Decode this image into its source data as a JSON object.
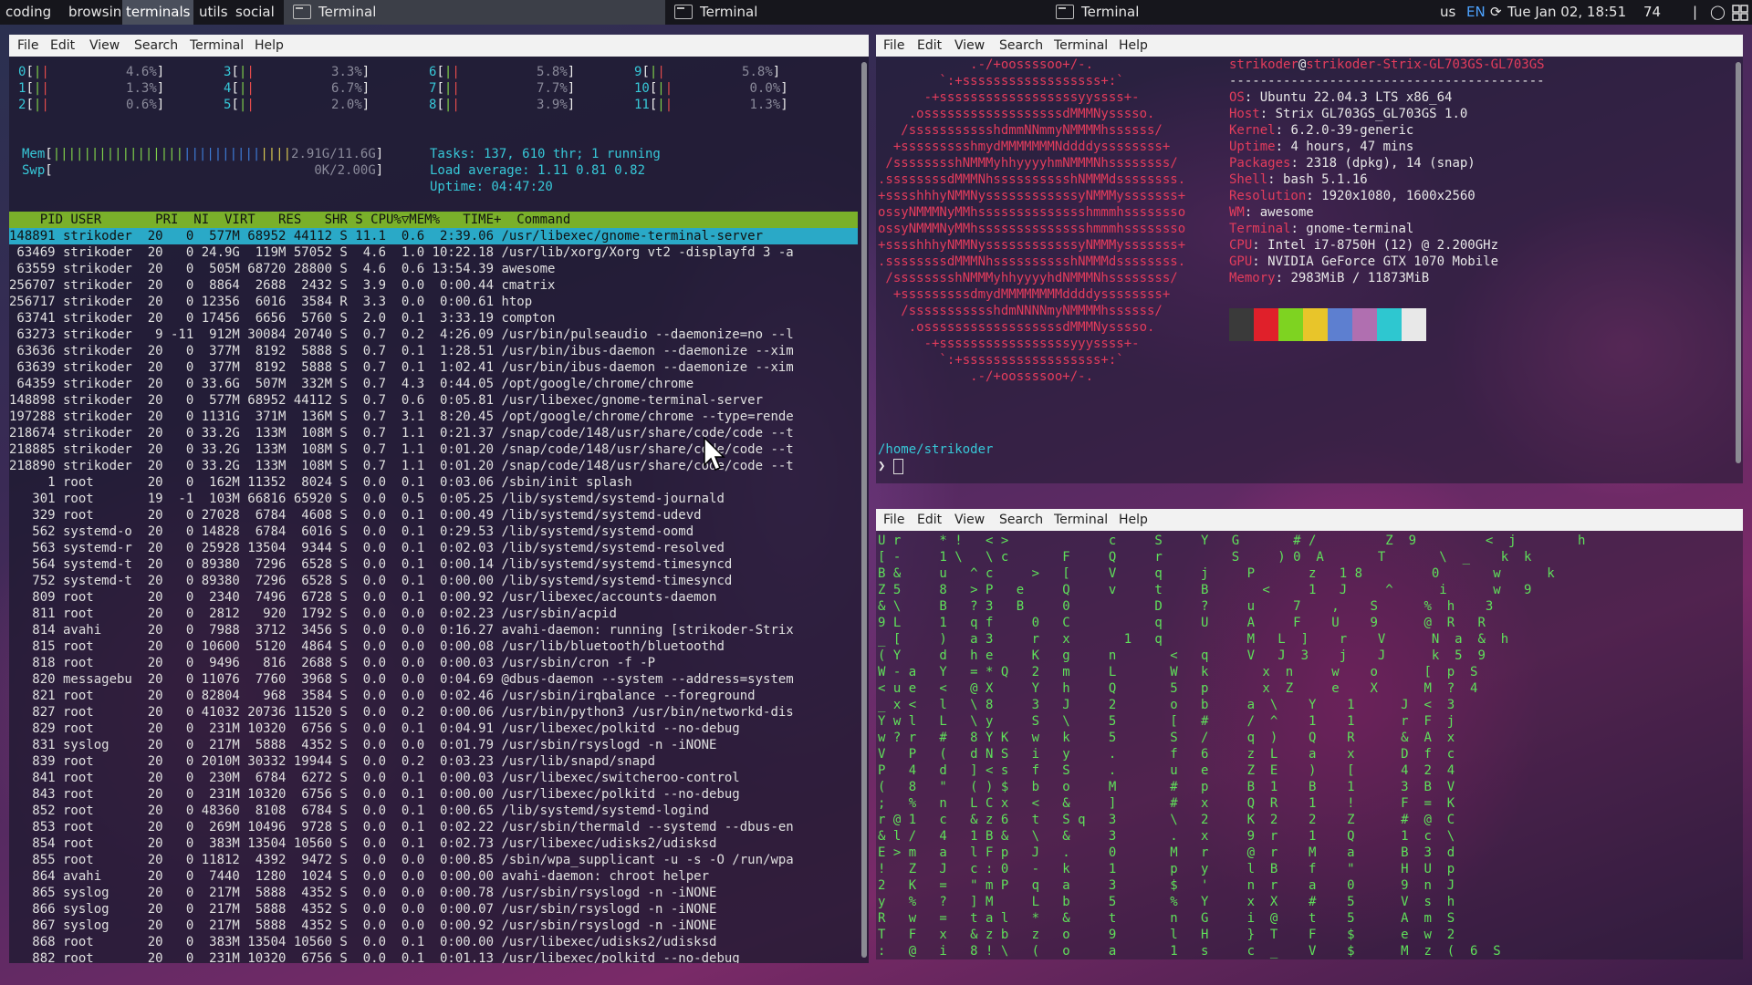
{
  "topbar": {
    "workspaces": [
      "coding",
      "browsing",
      "terminals",
      "utils",
      "social"
    ],
    "active_workspace": "terminals",
    "tasks": [
      "Terminal",
      "Terminal",
      "Terminal"
    ],
    "layout_indicator": "us",
    "lang": "EN",
    "clock": "Tue Jan 02, 18:51",
    "battery": "74"
  },
  "menu": [
    "File",
    "Edit",
    "View",
    "Search",
    "Terminal",
    "Help"
  ],
  "htop": {
    "cpus": [
      {
        "id": "0",
        "pct": "4.6%"
      },
      {
        "id": "1",
        "pct": "1.3%"
      },
      {
        "id": "2",
        "pct": "0.6%"
      },
      {
        "id": "3",
        "pct": "3.3%"
      },
      {
        "id": "4",
        "pct": "6.7%"
      },
      {
        "id": "5",
        "pct": "2.0%"
      },
      {
        "id": "6",
        "pct": "5.8%"
      },
      {
        "id": "7",
        "pct": "7.7%"
      },
      {
        "id": "8",
        "pct": "3.9%"
      },
      {
        "id": "9",
        "pct": "5.8%"
      },
      {
        "id": "10",
        "pct": "0.0%"
      },
      {
        "id": "11",
        "pct": "1.3%"
      }
    ],
    "mem": "2.91G/11.6G",
    "swp": "0K/2.00G",
    "tasks": "Tasks: 137, 610 thr; 1 running",
    "load": "Load average: 1.11 0.81 0.82",
    "uptime": "Uptime: 04:47:20",
    "header": "    PID USER       PRI  NI  VIRT   RES   SHR S CPU%▽MEM%   TIME+  Command",
    "rows": [
      "148891 strikoder  20   0  577M 68952 44112 S 11.1  0.6  2:39.06 /usr/libexec/gnome-terminal-server",
      " 63469 strikoder  20   0 24.9G  119M 57052 S  4.6  1.0 10:22.18 /usr/lib/xorg/Xorg vt2 -displayfd 3 -a",
      " 63559 strikoder  20   0  505M 68720 28800 S  4.6  0.6 13:54.39 awesome",
      "256707 strikoder  20   0  8864  2688  2432 S  3.9  0.0  0:00.44 cmatrix",
      "256717 strikoder  20   0 12356  6016  3584 R  3.3  0.0  0:00.61 htop",
      " 63741 strikoder  20   0 17456  6656  5760 S  2.0  0.1  3:33.19 compton",
      " 63273 strikoder   9 -11  912M 30084 20740 S  0.7  0.2  4:26.09 /usr/bin/pulseaudio --daemonize=no --l",
      " 63636 strikoder  20   0  377M  8192  5888 S  0.7  0.1  1:28.51 /usr/bin/ibus-daemon --daemonize --xim",
      " 63639 strikoder  20   0  377M  8192  5888 S  0.7  0.1  1:02.41 /usr/bin/ibus-daemon --daemonize --xim",
      " 64359 strikoder  20   0 33.6G  507M  332M S  0.7  4.3  0:44.05 /opt/google/chrome/chrome",
      "148898 strikoder  20   0  577M 68952 44112 S  0.7  0.6  0:05.81 /usr/libexec/gnome-terminal-server",
      "197288 strikoder  20   0 1131G  371M  136M S  0.7  3.1  8:20.45 /opt/google/chrome/chrome --type=rende",
      "218674 strikoder  20   0 33.2G  133M  108M S  0.7  1.1  0:21.37 /snap/code/148/usr/share/code/code --t",
      "218885 strikoder  20   0 33.2G  133M  108M S  0.7  1.1  0:01.20 /snap/code/148/usr/share/code/code --t",
      "218890 strikoder  20   0 33.2G  133M  108M S  0.7  1.1  0:01.20 /snap/code/148/usr/share/code/code --t",
      "     1 root       20   0  162M 11352  8024 S  0.0  0.1  0:03.06 /sbin/init splash",
      "   301 root       19  -1  103M 66816 65920 S  0.0  0.5  0:05.25 /lib/systemd/systemd-journald",
      "   329 root       20   0 27028  6784  4608 S  0.0  0.1  0:00.49 /lib/systemd/systemd-udevd",
      "   562 systemd-o  20   0 14828  6784  6016 S  0.0  0.1  0:29.53 /lib/systemd/systemd-oomd",
      "   563 systemd-r  20   0 25928 13504  9344 S  0.0  0.1  0:02.03 /lib/systemd/systemd-resolved",
      "   564 systemd-t  20   0 89380  7296  6528 S  0.0  0.1  0:00.14 /lib/systemd/systemd-timesyncd",
      "   752 systemd-t  20   0 89380  7296  6528 S  0.0  0.1  0:00.00 /lib/systemd/systemd-timesyncd",
      "   809 root       20   0  2340  7496  6728 S  0.0  0.1  0:00.92 /usr/libexec/accounts-daemon",
      "   811 root       20   0  2812   920  1792 S  0.0  0.0  0:02.23 /usr/sbin/acpid",
      "   814 avahi      20   0  7988  3712  3456 S  0.0  0.0  0:16.27 avahi-daemon: running [strikoder-Strix",
      "   815 root       20   0 10600  5120  4864 S  0.0  0.0  0:00.08 /usr/lib/bluetooth/bluetoothd",
      "   818 root       20   0  9496   816  2688 S  0.0  0.0  0:00.03 /usr/sbin/cron -f -P",
      "   820 messagebu  20   0 11076  7760  3968 S  0.0  0.0  0:04.69 @dbus-daemon --system --address=system",
      "   821 root       20   0 82804   968  3584 S  0.0  0.0  0:02.46 /usr/sbin/irqbalance --foreground",
      "   827 root       20   0 41032 20736 11520 S  0.0  0.2  0:00.06 /usr/bin/python3 /usr/bin/networkd-dis",
      "   829 root       20   0  231M 10320  6756 S  0.0  0.1  0:04.91 /usr/libexec/polkitd --no-debug",
      "   831 syslog     20   0  217M  5888  4352 S  0.0  0.0  0:01.79 /usr/sbin/rsyslogd -n -iNONE",
      "   839 root       20   0 2010M 30332 19944 S  0.0  0.2  0:03.23 /usr/lib/snapd/snapd",
      "   841 root       20   0  230M  6784  6272 S  0.0  0.1  0:00.03 /usr/libexec/switcheroo-control",
      "   843 root       20   0  231M 10320  6756 S  0.0  0.1  0:00.00 /usr/libexec/polkitd --no-debug",
      "   852 root       20   0 48360  8108  6784 S  0.0  0.1  0:00.65 /lib/systemd/systemd-logind",
      "   853 root       20   0  269M 10496  9728 S  0.0  0.1  0:02.22 /usr/sbin/thermald --systemd --dbus-en",
      "   854 root       20   0  383M 13504 10560 S  0.0  0.1  0:02.73 /usr/libexec/udisks2/udisksd",
      "   855 root       20   0 11812  4392  9472 S  0.0  0.0  0:00.85 /sbin/wpa_supplicant -u -s -O /run/wpa",
      "   864 avahi      20   0  7440  1280  1024 S  0.0  0.0  0:00.00 avahi-daemon: chroot helper",
      "   865 syslog     20   0  217M  5888  4352 S  0.0  0.0  0:00.78 /usr/sbin/rsyslogd -n -iNONE",
      "   866 syslog     20   0  217M  5888  4352 S  0.0  0.0  0:00.07 /usr/sbin/rsyslogd -n -iNONE",
      "   867 syslog     20   0  217M  5888  4352 S  0.0  0.0  0:00.92 /usr/sbin/rsyslogd -n -iNONE",
      "   868 root       20   0  383M 13504 10560 S  0.0  0.1  0:00.00 /usr/libexec/udisks2/udisksd",
      "   882 root       20   0  231M 10320  6756 S  0.0  0.1  0:01.13 /usr/libexec/polkitd --no-debug"
    ],
    "fkeys": [
      {
        "k": "F1",
        "v": "Help  "
      },
      {
        "k": "F2",
        "v": "Setup "
      },
      {
        "k": "F3",
        "v": "Search"
      },
      {
        "k": "F4",
        "v": "Filter"
      },
      {
        "k": "F5",
        "v": "Tree  "
      },
      {
        "k": "F6",
        "v": "SortBy"
      },
      {
        "k": "F7",
        "v": "Nice -"
      },
      {
        "k": "F8",
        "v": "Nice +"
      },
      {
        "k": "F9",
        "v": "Kill  "
      },
      {
        "k": "F10",
        "v": "Quit  "
      }
    ]
  },
  "neofetch": {
    "art": [
      "            .-/+oossssoo+/-.",
      "        `:+ssssssssssssssssss+:`",
      "      -+ssssssssssssssssssyyssss+-",
      "    .ossssssssssssssssssdMMMNysssso.",
      "   /ssssssssssshdmmNNmmyNMMMMhssssss/",
      "  +ssssssssshmydMMMMMMMNddddyssssssss+",
      " /sssssssshNMMMyhhyyyyhmNMMMNhssssssss/",
      ".ssssssssdMMMNhsssssssssshNMMMdssssssss.",
      "+sssshhhyNMMNyssssssssssssyNMMMysssssss+",
      "ossyNMMMNyMMhsssssssssssssshmmmhssssssso",
      "ossyNMMMNyMMhsssssssssssssshmmmhssssssso",
      "+sssshhhyNMMNyssssssssssssyNMMMysssssss+",
      ".ssssssssdMMMNhsssssssssshNMMMdssssssss.",
      " /sssssssshNMMMyhhyyyyhdNMMMNhssssssss/",
      "  +sssssssssdmydMMMMMMMMddddyssssssss+",
      "   /ssssssssssshdmNNNNmyNMMMMhssssss/",
      "    .ossssssssssssssssssdMMMNysssso.",
      "      -+sssssssssssssssssyyyssss+-",
      "        `:+ssssssssssssssssss+:`",
      "            .-/+oossssoo+/-."
    ],
    "user": "strikoder",
    "host": "strikoder-Strix-GL703GS-GL703GS",
    "separator": "-----------------------------------------",
    "info": [
      {
        "k": "OS",
        "v": "Ubuntu 22.04.3 LTS x86_64"
      },
      {
        "k": "Host",
        "v": "Strix GL703GS_GL703GS 1.0"
      },
      {
        "k": "Kernel",
        "v": "6.2.0-39-generic"
      },
      {
        "k": "Uptime",
        "v": "4 hours, 47 mins"
      },
      {
        "k": "Packages",
        "v": "2318 (dpkg), 14 (snap)"
      },
      {
        "k": "Shell",
        "v": "bash 5.1.16"
      },
      {
        "k": "Resolution",
        "v": "1920x1080, 1600x2560"
      },
      {
        "k": "WM",
        "v": "awesome"
      },
      {
        "k": "Terminal",
        "v": "gnome-terminal"
      },
      {
        "k": "CPU",
        "v": "Intel i7-8750H (12) @ 2.200GHz"
      },
      {
        "k": "GPU",
        "v": "NVIDIA GeForce GTX 1070 Mobile"
      },
      {
        "k": "Memory",
        "v": "2983MiB / 11873MiB"
      }
    ],
    "swatches": [
      "#3a3a3a",
      "#e0202a",
      "#7ed321",
      "#e8c52a",
      "#5d7fd0",
      "#b06fb0",
      "#2ec7d0",
      "#e8e8e8"
    ],
    "cwd": "/home/strikoder",
    "prompt": "❯"
  },
  "matrix": {
    "lines": [
      "U r     * !   < >             c     S     Y   G       # /         Z  9         <  j        h",
      "[ -     1 \\   \\ c       F     Q     r         S     ) 0  A       T       \\  _    k  k",
      "B &     u   ^ c     >   [     V     q     j     P       z   1 8         0       w      k",
      "Z 5     8   > P   e     Q     v     t     B       <     1   J     ^      i      w   9",
      "& \\     B   ? 3   B     0           D     ?     u     7    ,    S      %  h    3",
      "9 L     1   q f     0   C           q     U     A     F    U    9      @  R   R",
      "_ [     )   a 3     r   x       1   q           M   L  ]    r    V      N  a  &  h",
      "( Y     d   h e     K   g     n       <   q     V   J  3    j    J      k  5  9",
      "W - a   Y   = * Q   2   m     L       W   k       x  n     w    o      [  p  S",
      "< u e   <   @ X     Y   h     Q       5   p       x  Z     e    X      M  ?  4",
      "_ x <   l   \\ 8     3   J     2       o   b     a  \\    Y    1      J  <  3",
      "Y w l   L   \\ y     S   \\     5       [   #     /  ^    1    1      r  F  j",
      "w ? r   #   8 Y K   w   k     5       S   /     q  )    Q    R      &  A  x",
      "V   P   (   d N S   i   y     .       f   6     z  L    a    x      D  f  c",
      "P   4   d   ] < s   f   S     .       u   e     Z  E    )    [      4  2  4",
      "(   8   \"   ( ) $   b   o     M       #   p     B  1    B    1      3  B  V",
      ";   %   n   L C x   <   &     ]       #   x     Q  R    1    !      F  =  K",
      "r @ 1   c   & z 6   t   S q   3       \\   2     K  2    2    Z      #  @  C",
      "& l /   4   1 B &   \\   &     3       .   x     9  r    1    Q      1  c  \\",
      "E > m   a   l F p   J   .     0       M   r     @  r    M    a      B  3  d",
      "!   Z   J   c : 0   -   k     1       p   y     l  B    f    \"      H  U  p",
      "2   K   =   \" m P   q   a     3       $   '     n  r    a    0      9  n  J",
      "y   %   ?   ] M     L   b     5       %   Y     x  X    #    5      V  s  h",
      "R   w   =   t a l   *   &     t       n   G     i  @    t    5      A  m  S",
      "T   F   x   & z b   z   o     9       l   H     }  T    F    $      e  w  2",
      ":   @   i   8 ! \\   (   o     a       1   s     c  _    V    $      M  z  (  6  S"
    ]
  }
}
